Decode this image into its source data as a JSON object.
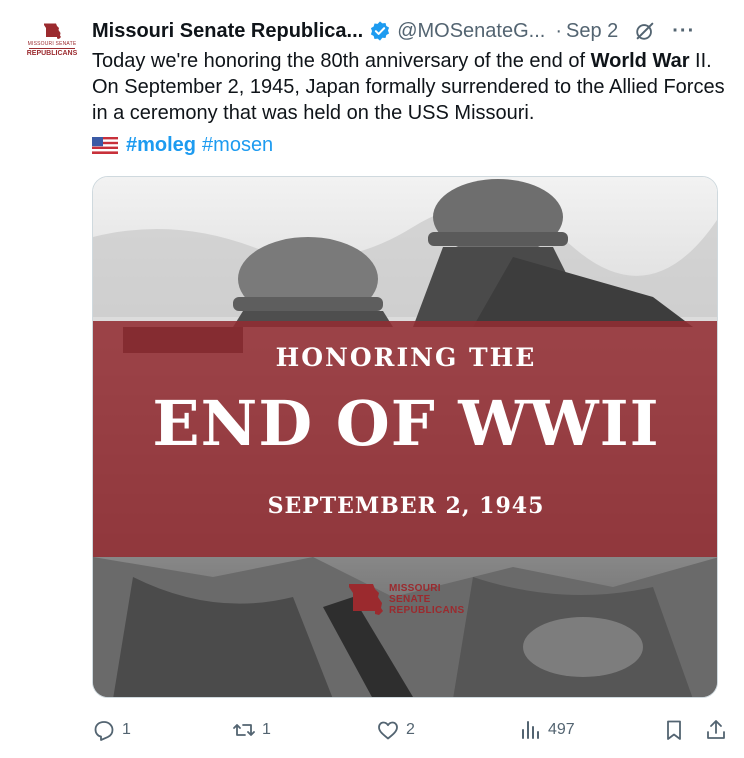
{
  "account": {
    "display_name": "Missouri Senate Republica...",
    "handle": "@MOSenateG...",
    "date": "Sep 2",
    "separator": "·",
    "avatar_text_line1": "MISSOURI SENATE",
    "avatar_text_line2": "REPUBLICANS",
    "verified": true
  },
  "tweet": {
    "text_before_bold": "Today we're honoring the 80th anniversary of the end of ",
    "bold_phrase": "World War",
    "text_after_bold": " II. On September 2, 1945, Japan formally surrendered to the Allied Forces in a ceremony that was held on the USS Missouri.",
    "hashtags": [
      {
        "text": "#moleg",
        "bold": true
      },
      {
        "text": "#mosen",
        "bold": false
      }
    ]
  },
  "media": {
    "headline_small": "HONORING THE",
    "headline_large": "END OF WWII",
    "headline_date": "SEPTEMBER 2, 1945",
    "logo_lines": [
      "MISSOURI",
      "SENATE",
      "REPUBLICANS"
    ],
    "banner_color": "#922c32"
  },
  "actions": {
    "replies": "1",
    "reposts": "1",
    "likes": "2",
    "views": "497"
  },
  "colors": {
    "text": "#0f1419",
    "secondary": "#536471",
    "link": "#1d9bf0",
    "brand": "#9b2a2e",
    "verified": "#1d9bf0"
  },
  "icons": {
    "header": [
      "verified-badge-icon",
      "grok-icon",
      "more-icon"
    ],
    "actions": [
      "reply-icon",
      "repost-icon",
      "like-icon",
      "views-icon",
      "bookmark-icon",
      "share-icon"
    ]
  }
}
